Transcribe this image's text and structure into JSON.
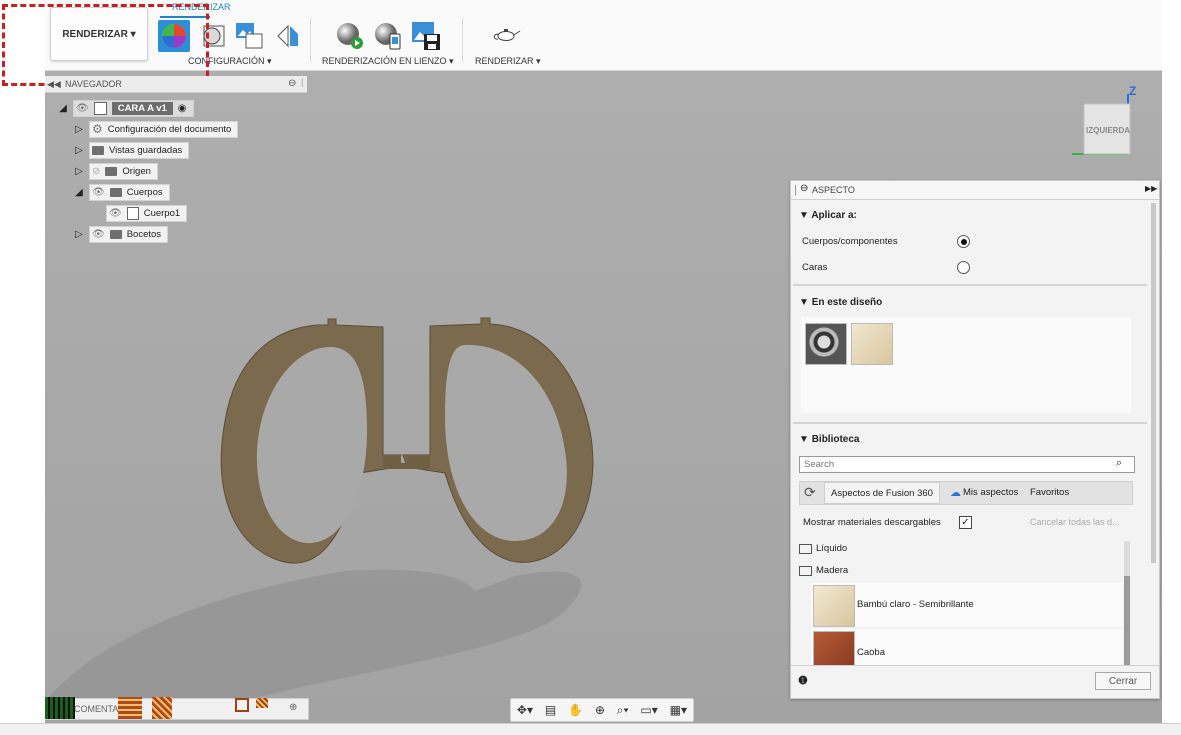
{
  "toolbar": {
    "workspace_label": "RENDERIZAR ▾",
    "active_tab": "RENDERIZAR",
    "groups": {
      "config": "CONFIGURACIÓN ▾",
      "canvas_render": "RENDERIZACIÓN EN LIENZO ▾",
      "render": "RENDERIZAR ▾"
    }
  },
  "navigator": {
    "title": "NAVEGADOR",
    "root": "CARA  A v1",
    "items": [
      {
        "label": "Configuración del documento"
      },
      {
        "label": "Vistas guardadas"
      },
      {
        "label": "Origen"
      },
      {
        "label": "Cuerpos"
      },
      {
        "label": "Cuerpo1"
      },
      {
        "label": "Bocetos"
      }
    ]
  },
  "viewcube": {
    "face": "IZQUIERDA",
    "axis": "Z"
  },
  "aspect_panel": {
    "title": "ASPECTO",
    "apply_to": {
      "heading": "Aplicar a:",
      "options": [
        {
          "label": "Cuerpos/componentes",
          "selected": true
        },
        {
          "label": "Caras",
          "selected": false
        }
      ]
    },
    "in_design": {
      "heading": "En este diseño"
    },
    "library": {
      "heading": "Biblioteca",
      "search_placeholder": "Search",
      "tabs": [
        "Aspectos de Fusion 360",
        "Mis aspectos",
        "Favoritos"
      ],
      "show_downloadable_label": "Mostrar materiales descargables",
      "show_downloadable_checked": true,
      "cancel_all": "Cancelar todas las d...",
      "folders": [
        "Líquido",
        "Madera"
      ],
      "materials": [
        {
          "label": "Bambú claro - Semibrillante",
          "color": "#e9dcc0"
        },
        {
          "label": "Caoba",
          "color": "#9a4a2c"
        }
      ]
    },
    "close_button": "Cerrar"
  },
  "comments": {
    "title": "COMENTARIOS"
  },
  "colors": {
    "accent": "#1f86c8",
    "wood": "#7b6a4d",
    "selection_dash": "#cc1e1e"
  }
}
